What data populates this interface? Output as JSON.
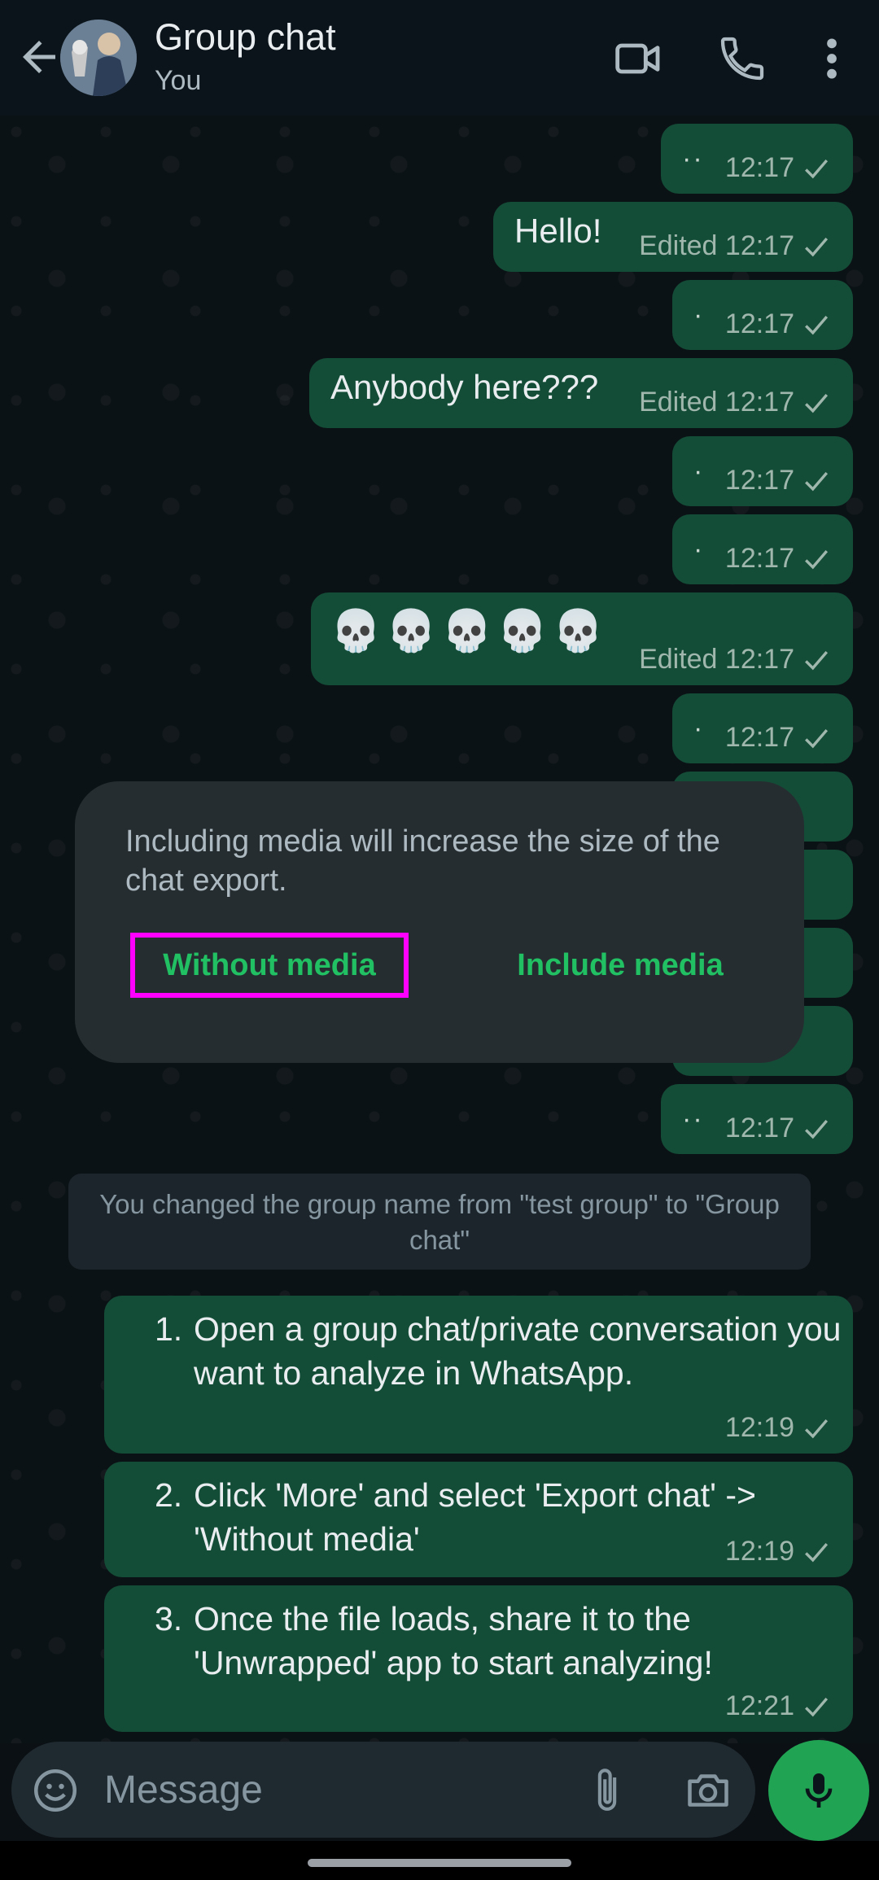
{
  "header": {
    "title": "Group chat",
    "subtitle": "You"
  },
  "messages": [
    {
      "text": "··",
      "time": "12:17"
    },
    {
      "text": "Hello!",
      "time": "Edited 12:17"
    },
    {
      "text": "·",
      "time": "12:17"
    },
    {
      "text": "Anybody here???",
      "time": "Edited 12:17"
    },
    {
      "text": "·",
      "time": "12:17"
    },
    {
      "text": "·",
      "time": "12:17"
    },
    {
      "text": "💀💀💀💀💀",
      "time": "Edited 12:17"
    },
    {
      "text": "·",
      "time": "12:17"
    },
    {
      "text": "··",
      "time": "12:17"
    }
  ],
  "system_message": "You changed the group name from \"test group\" to \"Group chat\"",
  "list_messages": [
    {
      "num": "1.",
      "text": "Open a group chat/private conversation you want to analyze in WhatsApp.",
      "time": "12:19"
    },
    {
      "num": "2.",
      "text": "Click 'More' and select 'Export chat' -> 'Without media'",
      "time": "12:19"
    },
    {
      "num": "3.",
      "text": "Once the file loads, share it to the 'Unwrapped' app to start analyzing!",
      "time": "12:21"
    }
  ],
  "dialog": {
    "text": "Including media will increase the size of the chat export.",
    "without_label": "Without media",
    "include_label": "Include media"
  },
  "composer": {
    "placeholder": "Message"
  },
  "icons": {
    "back": "arrow-left-icon",
    "video": "video-camera-icon",
    "call": "phone-icon",
    "menu": "more-vertical-icon",
    "emoji": "smiley-icon",
    "attach": "paperclip-icon",
    "camera": "camera-icon",
    "mic": "microphone-icon"
  },
  "colors": {
    "accent": "#21c063",
    "bubble": "#144d37",
    "highlight": "#ff00ff"
  }
}
